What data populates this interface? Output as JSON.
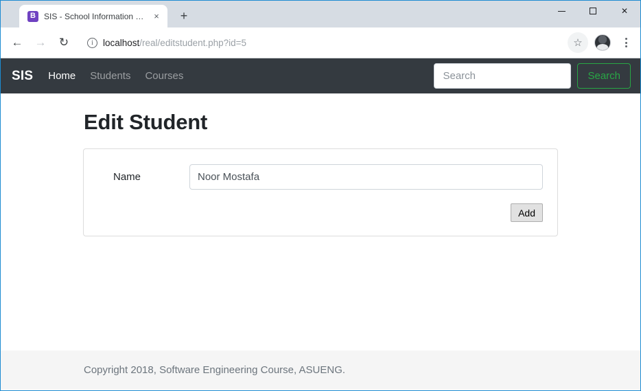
{
  "browser": {
    "tab": {
      "favicon_letter": "B",
      "favicon_icon": "bootstrap-favicon",
      "title": "SIS - School Information System",
      "close_icon": "×"
    },
    "new_tab_icon": "+",
    "window_controls": {
      "minimize": "minimize-icon",
      "maximize": "maximize-icon",
      "close": "✕"
    },
    "toolbar": {
      "back_icon": "←",
      "forward_icon": "→",
      "reload_icon": "↻",
      "site_info_icon": "i",
      "url_host": "localhost",
      "url_path": "/real/editstudent.php?id=5",
      "bookmark_icon": "☆",
      "profile_icon": "profile-avatar",
      "menu_icon": "three-dot-menu"
    }
  },
  "navbar": {
    "brand": "SIS",
    "links": [
      {
        "label": "Home",
        "active": true
      },
      {
        "label": "Students",
        "active": false
      },
      {
        "label": "Courses",
        "active": false
      }
    ],
    "search": {
      "placeholder": "Search",
      "value": "",
      "button_label": "Search",
      "button_color": "#28a745"
    },
    "background_color": "#343a40"
  },
  "main": {
    "page_title": "Edit Student",
    "form": {
      "name_label": "Name",
      "name_value": "Noor Mostafa",
      "name_placeholder": "",
      "submit_label": "Add"
    }
  },
  "footer": {
    "text": "Copyright 2018, Software Engineering Course, ASUENG."
  }
}
